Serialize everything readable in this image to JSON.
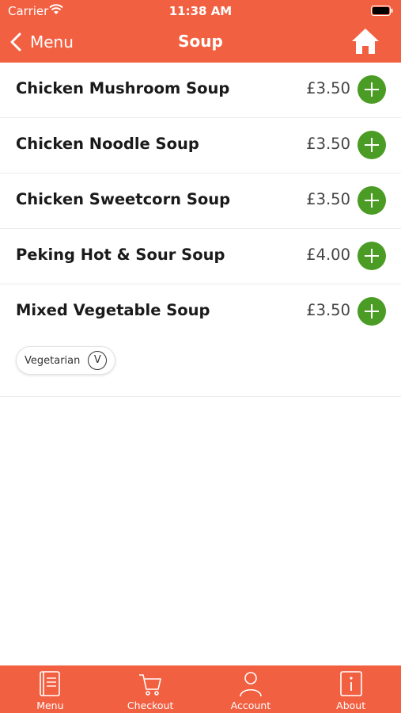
{
  "status_bar": {
    "carrier": "Carrier",
    "time": "11:38 AM"
  },
  "nav": {
    "back_label": "Menu",
    "title": "Soup"
  },
  "items": [
    {
      "name": "Chicken Mushroom Soup",
      "price": "£3.50"
    },
    {
      "name": "Chicken Noodle Soup",
      "price": "£3.50"
    },
    {
      "name": "Chicken Sweetcorn Soup",
      "price": "£3.50"
    },
    {
      "name": "Peking Hot & Sour Soup",
      "price": "£4.00"
    },
    {
      "name": "Mixed Vegetable Soup",
      "price": "£3.50",
      "tag": {
        "label": "Vegetarian",
        "symbol": "V"
      }
    }
  ],
  "tabs": [
    {
      "label": "Menu",
      "icon": "menu-book-icon"
    },
    {
      "label": "Checkout",
      "icon": "cart-icon"
    },
    {
      "label": "Account",
      "icon": "user-icon"
    },
    {
      "label": "About",
      "icon": "info-icon"
    }
  ],
  "colors": {
    "brand": "#f26042",
    "add_button": "#4a9c24"
  }
}
